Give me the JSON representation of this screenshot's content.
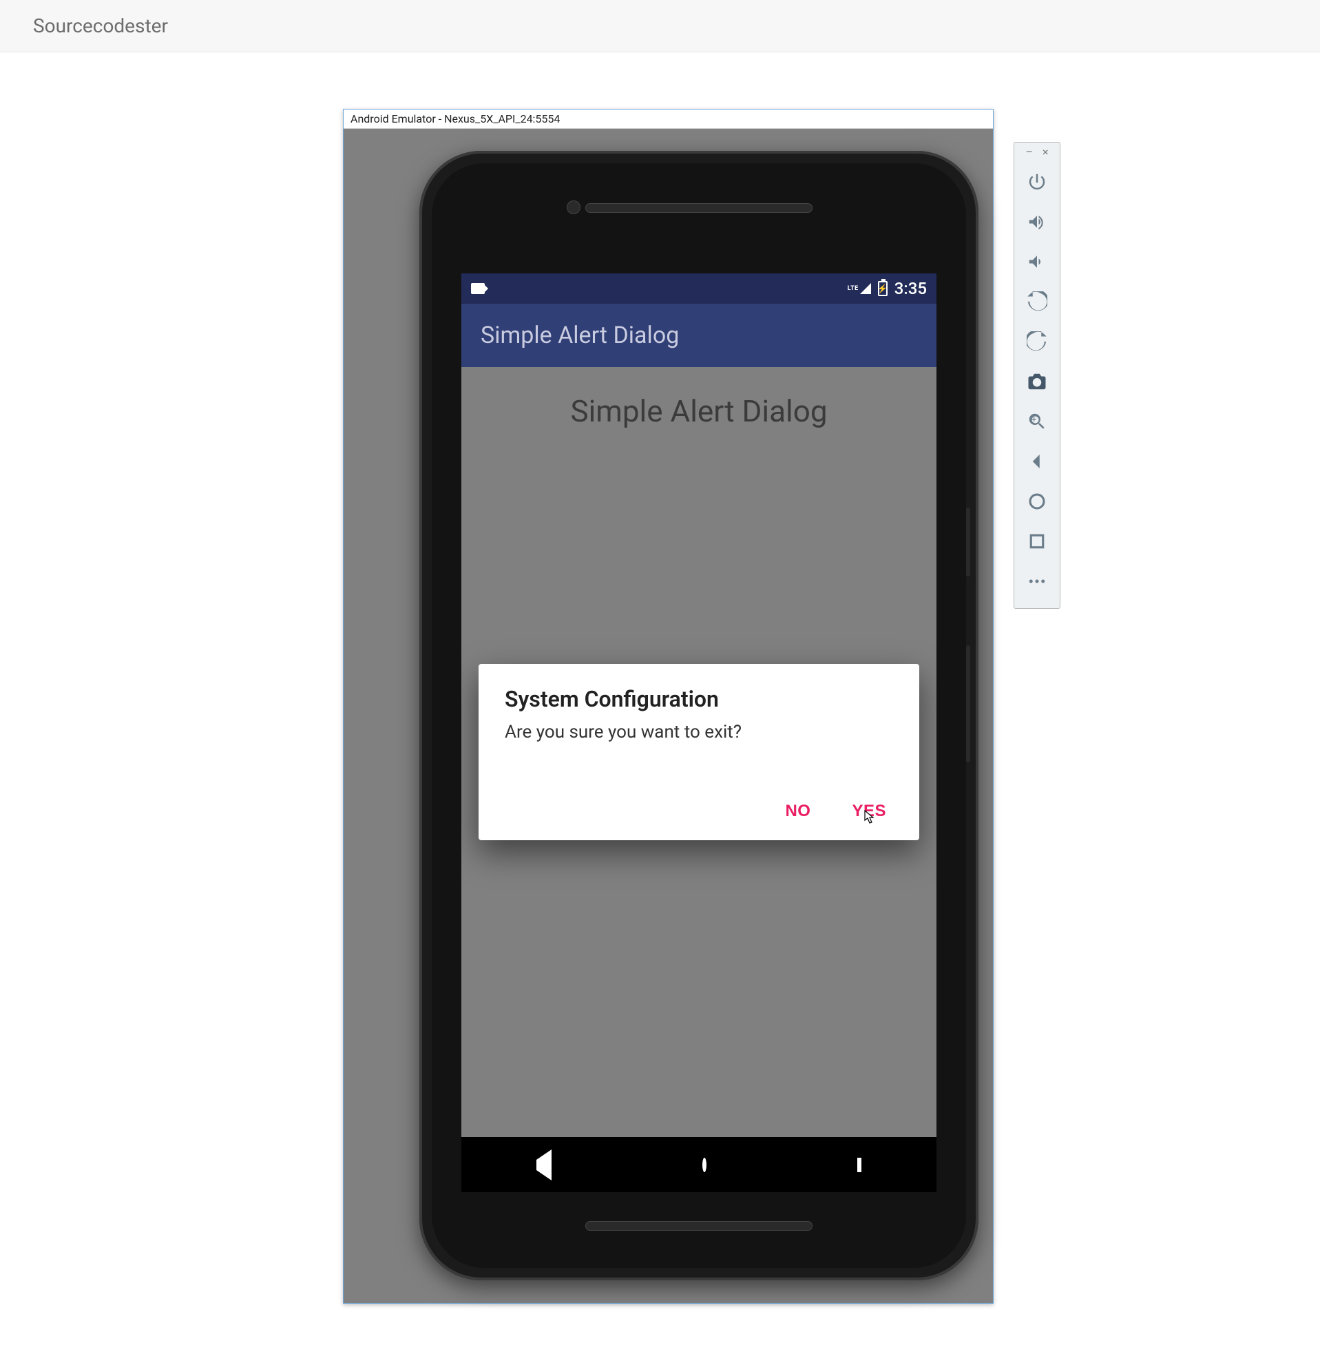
{
  "page": {
    "site_title": "Sourcecodester"
  },
  "emulator": {
    "window_title": "Android Emulator - Nexus_5X_API_24:5554",
    "toolbar": {
      "minimize": "–",
      "close": "×",
      "buttons": [
        {
          "name": "power-icon"
        },
        {
          "name": "volume-up-icon"
        },
        {
          "name": "volume-down-icon"
        },
        {
          "name": "rotate-left-icon"
        },
        {
          "name": "rotate-right-icon"
        },
        {
          "name": "camera-icon"
        },
        {
          "name": "zoom-in-icon"
        },
        {
          "name": "back-icon"
        },
        {
          "name": "home-icon"
        },
        {
          "name": "overview-icon"
        },
        {
          "name": "more-icon"
        }
      ]
    }
  },
  "phone": {
    "status": {
      "network": "LTE",
      "time": "3:35"
    },
    "app_bar_title": "Simple Alert Dialog",
    "content_heading": "Simple Alert Dialog",
    "dialog": {
      "title": "System Configuration",
      "message": "Are you sure you want to exit?",
      "no_label": "NO",
      "yes_label": "YES"
    }
  },
  "colors": {
    "status_bar": "#232c59",
    "app_bar": "#303f75",
    "accent": "#e91e63"
  }
}
